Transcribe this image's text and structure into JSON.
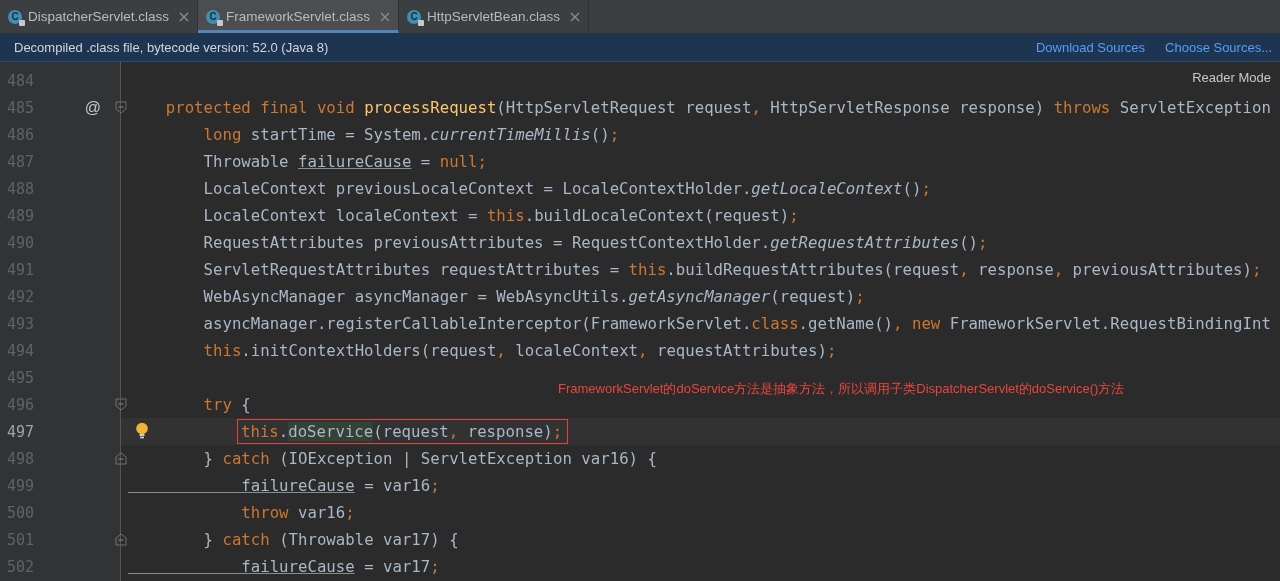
{
  "tabs": [
    {
      "label": "DispatcherServlet.class",
      "icon_letter": "C",
      "selected": false
    },
    {
      "label": "FrameworkServlet.class",
      "icon_letter": "C",
      "selected": true
    },
    {
      "label": "HttpServletBean.class",
      "icon_letter": "C",
      "selected": false
    }
  ],
  "info_bar": {
    "text": "Decompiled .class file, bytecode version: 52.0 (Java 8)",
    "links": [
      "Download Sources",
      "Choose Sources..."
    ]
  },
  "reader_mode": "Reader Mode",
  "lines": [
    {
      "number": "484"
    },
    {
      "number": "485",
      "marker": "@",
      "fold_start": true,
      "code": [
        {
          "text": "    protected final void ",
          "kind": "keyword"
        },
        {
          "text": "processRequest",
          "kind": "method-decl"
        },
        {
          "text": "(HttpServletRequest request",
          "kind": "plain"
        },
        {
          "text": ",",
          "kind": "punct"
        },
        {
          "text": " HttpServletResponse response) ",
          "kind": "plain"
        },
        {
          "text": "throws",
          "kind": "keyword"
        },
        {
          "text": " ServletException",
          "kind": "plain"
        }
      ]
    },
    {
      "number": "486",
      "code": [
        {
          "text": "        long",
          "kind": "keyword"
        },
        {
          "text": " startTime = System.",
          "kind": "plain"
        },
        {
          "text": "currentTimeMillis",
          "kind": "static-call"
        },
        {
          "text": "()",
          "kind": "plain"
        },
        {
          "text": ";",
          "kind": "punct"
        }
      ]
    },
    {
      "number": "487",
      "code": [
        {
          "text": "        Throwable ",
          "kind": "plain"
        },
        {
          "text": "failureCause",
          "kind": "reassigned"
        },
        {
          "text": " = ",
          "kind": "plain"
        },
        {
          "text": "null",
          "kind": "keyword"
        },
        {
          "text": ";",
          "kind": "punct"
        }
      ]
    },
    {
      "number": "488",
      "code": [
        {
          "text": "        LocaleContext previousLocaleContext = LocaleContextHolder.",
          "kind": "plain"
        },
        {
          "text": "getLocaleContext",
          "kind": "static-call"
        },
        {
          "text": "()",
          "kind": "plain"
        },
        {
          "text": ";",
          "kind": "punct"
        }
      ]
    },
    {
      "number": "489",
      "code": [
        {
          "text": "        LocaleContext localeContext = ",
          "kind": "plain"
        },
        {
          "text": "this",
          "kind": "keyword"
        },
        {
          "text": ".buildLocaleContext(request)",
          "kind": "plain"
        },
        {
          "text": ";",
          "kind": "punct"
        }
      ]
    },
    {
      "number": "490",
      "code": [
        {
          "text": "        RequestAttributes previousAttributes = RequestContextHolder.",
          "kind": "plain"
        },
        {
          "text": "getRequestAttributes",
          "kind": "static-call"
        },
        {
          "text": "()",
          "kind": "plain"
        },
        {
          "text": ";",
          "kind": "punct"
        }
      ]
    },
    {
      "number": "491",
      "code": [
        {
          "text": "        ServletRequestAttributes requestAttributes = ",
          "kind": "plain"
        },
        {
          "text": "this",
          "kind": "keyword"
        },
        {
          "text": ".buildRequestAttributes(request",
          "kind": "plain"
        },
        {
          "text": ",",
          "kind": "punct"
        },
        {
          "text": " response",
          "kind": "plain"
        },
        {
          "text": ",",
          "kind": "punct"
        },
        {
          "text": " previousAttributes)",
          "kind": "plain"
        },
        {
          "text": ";",
          "kind": "punct"
        }
      ]
    },
    {
      "number": "492",
      "code": [
        {
          "text": "        WebAsyncManager asyncManager = WebAsyncUtils.",
          "kind": "plain"
        },
        {
          "text": "getAsyncManager",
          "kind": "static-call"
        },
        {
          "text": "(request)",
          "kind": "plain"
        },
        {
          "text": ";",
          "kind": "punct"
        }
      ]
    },
    {
      "number": "493",
      "code": [
        {
          "text": "        asyncManager.registerCallableInterceptor(FrameworkServlet.",
          "kind": "plain"
        },
        {
          "text": "class",
          "kind": "keyword"
        },
        {
          "text": ".getName()",
          "kind": "plain"
        },
        {
          "text": ", ",
          "kind": "punct"
        },
        {
          "text": "new",
          "kind": "keyword"
        },
        {
          "text": " FrameworkServlet.RequestBindingInt",
          "kind": "plain"
        }
      ]
    },
    {
      "number": "494",
      "code": [
        {
          "text": "        this",
          "kind": "keyword"
        },
        {
          "text": ".initContextHolders(request",
          "kind": "plain"
        },
        {
          "text": ",",
          "kind": "punct"
        },
        {
          "text": " localeContext",
          "kind": "plain"
        },
        {
          "text": ",",
          "kind": "punct"
        },
        {
          "text": " requestAttributes)",
          "kind": "plain"
        },
        {
          "text": ";",
          "kind": "punct"
        }
      ]
    },
    {
      "number": "495"
    },
    {
      "number": "496",
      "fold_start": true,
      "note": "FrameworkServlet的doService方法是抽象方法，所以调用子类DispatcherServlet的doService()方法",
      "code": [
        {
          "text": "        try",
          "kind": "keyword"
        },
        {
          "text": " {",
          "kind": "plain"
        }
      ]
    },
    {
      "number": "497",
      "current": true,
      "bulb": true,
      "boxed": true,
      "code": [
        {
          "text": "this",
          "kind": "keyword"
        },
        {
          "text": ".",
          "kind": "plain"
        },
        {
          "text": "doService",
          "kind": "highlight"
        },
        {
          "text": "(request",
          "kind": "plain"
        },
        {
          "text": ",",
          "kind": "punct"
        },
        {
          "text": " response)",
          "kind": "plain"
        },
        {
          "text": ";",
          "kind": "punct"
        }
      ]
    },
    {
      "number": "498",
      "fold_end": true,
      "code": [
        {
          "text": "        } ",
          "kind": "plain"
        },
        {
          "text": "catch",
          "kind": "keyword"
        },
        {
          "text": " (IOException | ServletException var16) {",
          "kind": "plain"
        }
      ]
    },
    {
      "number": "499",
      "code": [
        {
          "text": "            failureCause",
          "kind": "reassigned"
        },
        {
          "text": " = var16",
          "kind": "plain"
        },
        {
          "text": ";",
          "kind": "punct"
        }
      ]
    },
    {
      "number": "500",
      "code": [
        {
          "text": "            throw",
          "kind": "keyword"
        },
        {
          "text": " var16",
          "kind": "plain"
        },
        {
          "text": ";",
          "kind": "punct"
        }
      ]
    },
    {
      "number": "501",
      "fold_end": true,
      "code": [
        {
          "text": "        } ",
          "kind": "plain"
        },
        {
          "text": "catch",
          "kind": "keyword"
        },
        {
          "text": " (Throwable var17) {",
          "kind": "plain"
        }
      ]
    },
    {
      "number": "502",
      "code": [
        {
          "text": "            failureCause",
          "kind": "reassigned"
        },
        {
          "text": " = var17",
          "kind": "plain"
        },
        {
          "text": ";",
          "kind": "punct"
        }
      ]
    }
  ]
}
